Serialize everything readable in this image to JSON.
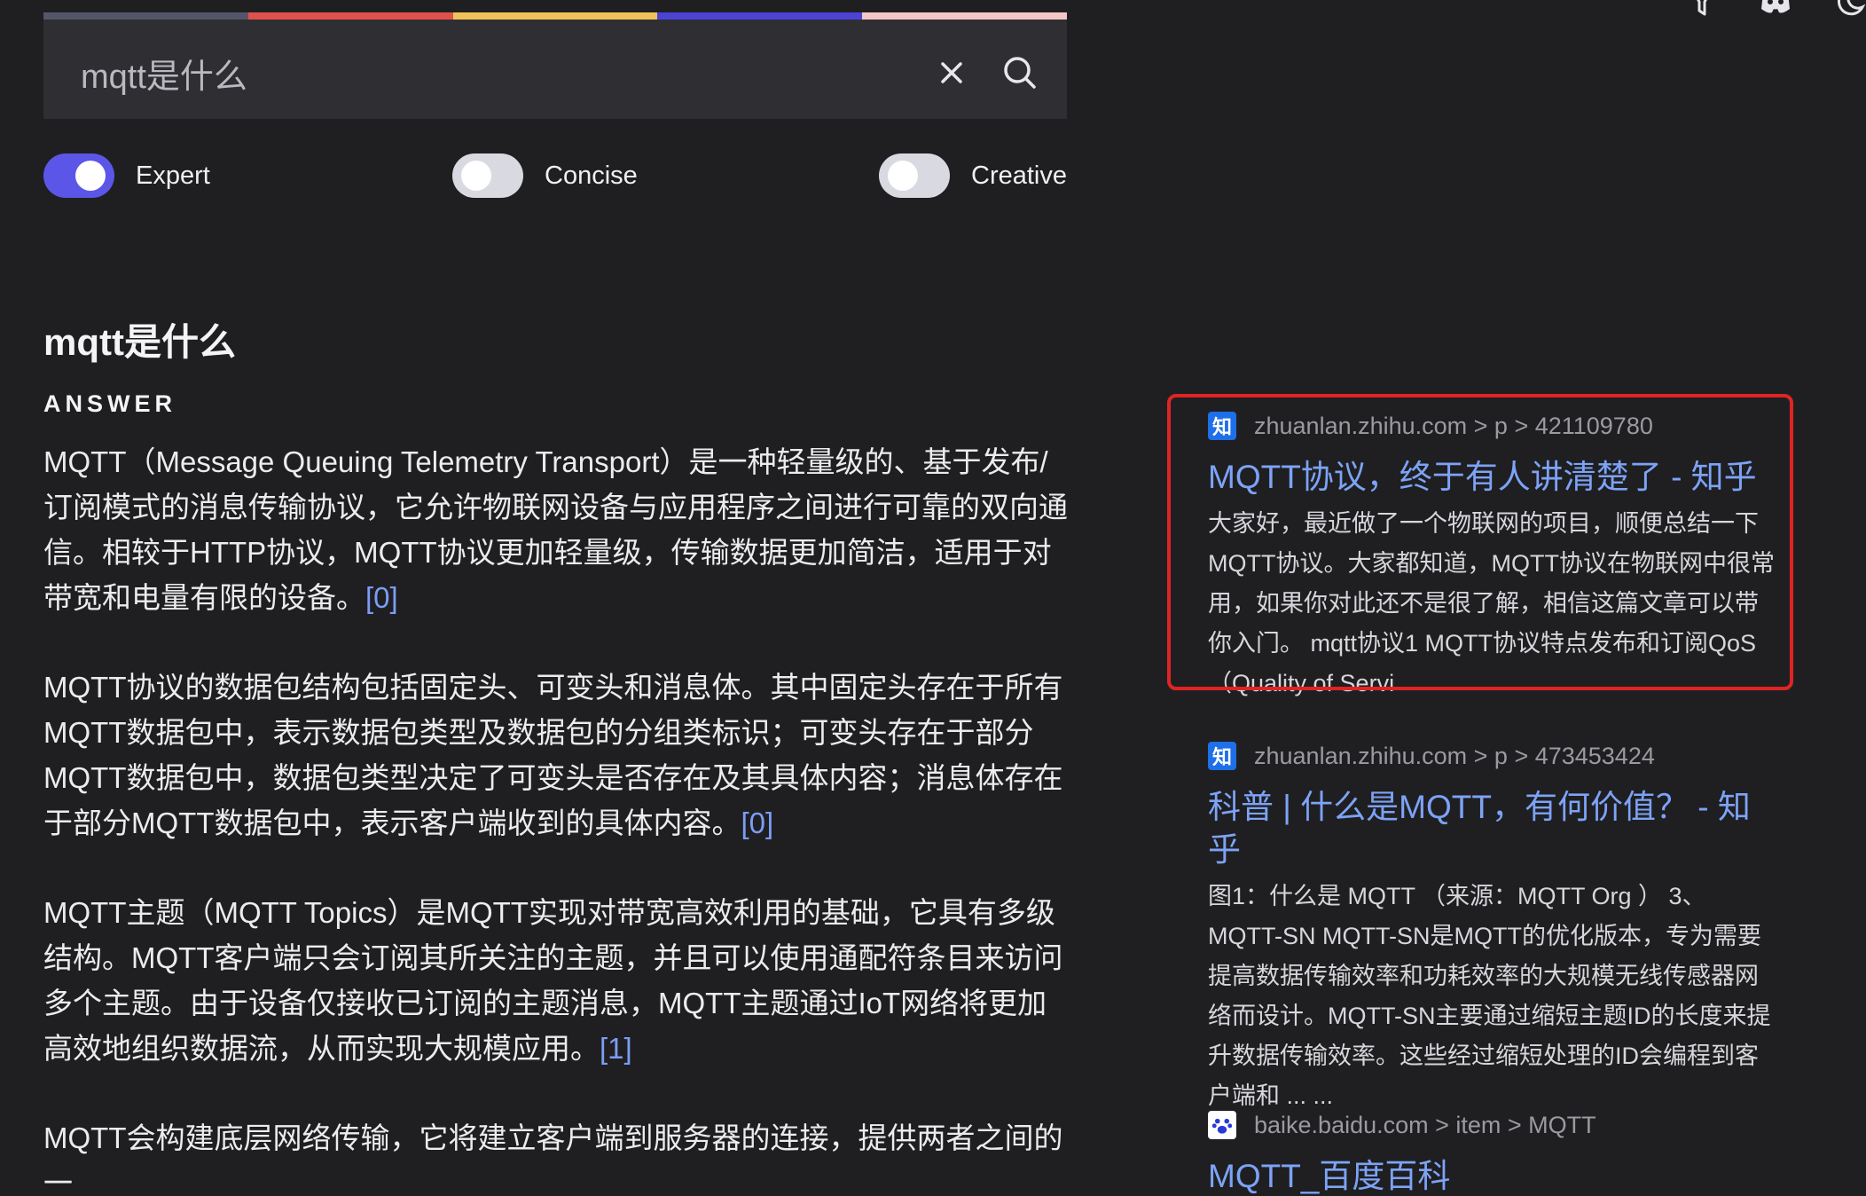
{
  "search": {
    "value": "mqtt是什么",
    "rainbow_colors": [
      "#55556a",
      "#e0514d",
      "#f0c25a",
      "#4a43d6",
      "#f4c6c6"
    ]
  },
  "toggles": [
    {
      "label": "Expert",
      "on": true
    },
    {
      "label": "Concise",
      "on": false
    },
    {
      "label": "Creative",
      "on": false
    }
  ],
  "question": "mqtt是什么",
  "answer_heading": "ANSWER",
  "paragraphs": [
    {
      "text": "MQTT（Message Queuing Telemetry Transport）是一种轻量级的、基于发布/订阅模式的消息传输协议，它允许物联网设备与应用程序之间进行可靠的双向通信。相较于HTTP协议，MQTT协议更加轻量级，传输数据更加简洁，适用于对带宽和电量有限的设备。",
      "cite": "[0]"
    },
    {
      "text": "MQTT协议的数据包结构包括固定头、可变头和消息体。其中固定头存在于所有MQTT数据包中，表示数据包类型及数据包的分组类标识；可变头存在于部分MQTT数据包中，数据包类型决定了可变头是否存在及其具体内容；消息体存在于部分MQTT数据包中，表示客户端收到的具体内容。",
      "cite": "[0]"
    },
    {
      "text": "MQTT主题（MQTT Topics）是MQTT实现对带宽高效利用的基础，它具有多级结构。MQTT客户端只会订阅其所关注的主题，并且可以使用通配符条目来访问多个主题。由于设备仅接收已订阅的主题消息，MQTT主题通过IoT网络将更加高效地组织数据流，从而实现大规模应用。",
      "cite": "[1]"
    },
    {
      "text": "MQTT会构建底层网络传输，它将建立客户端到服务器的连接，提供两者之间的一",
      "cite": ""
    }
  ],
  "sources": [
    {
      "favicon": "知",
      "url": "zhuanlan.zhihu.com > p > 421109780",
      "title": "MQTT协议，终于有人讲清楚了 - 知乎",
      "snippet": "大家好，最近做了一个物联网的项目，顺便总结一下MQTT协议。大家都知道，MQTT协议在物联网中很常用，如果你对此还不是很了解，相信这篇文章可以带你入门。 mqtt协议1 MQTT协议特点发布和订阅QoS（Quality of Servi"
    },
    {
      "favicon": "知",
      "url": "zhuanlan.zhihu.com > p > 473453424",
      "title": "科普 | 什么是MQTT，有何价值？ - 知乎",
      "snippet": "图1：什么是 MQTT （来源：MQTT Org ） 3、MQTT-SN MQTT-SN是MQTT的优化版本，专为需要提高数据传输效率和功耗效率的大规模无线传感器网络而设计。MQTT-SN主要通过缩短主题ID的长度来提升数据传输效率。这些经过缩短处理的ID会编程到客户端和 ... ..."
    },
    {
      "favicon": "",
      "url": "baike.baidu.com > item > MQTT",
      "title": "MQTT_百度百科",
      "snippet": ""
    }
  ],
  "icons": [
    "filter-icon",
    "discord-icon",
    "moon-icon",
    "close-icon",
    "search-icon",
    "baidu-paw-icon"
  ],
  "colors": {
    "accent": "#5c56e8",
    "link": "#7da3f7",
    "highlight": "#e02424",
    "zhihu": "#1e6fe8"
  }
}
